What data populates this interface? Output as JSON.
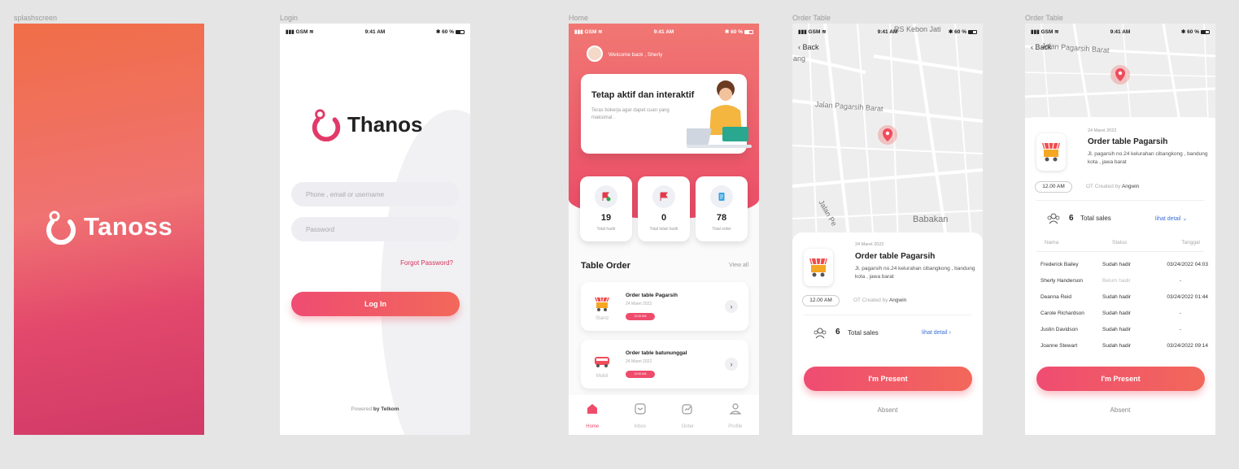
{
  "frames": {
    "splash": "splashscreen",
    "login": "Login",
    "home": "Home",
    "order1": "Order Table",
    "order2": "Order Table"
  },
  "status_bar": {
    "carrier": "GSM",
    "time": "9:41 AM",
    "battery": "60 %"
  },
  "splash": {
    "brand": "Tanoss"
  },
  "login": {
    "brand": "Thanos",
    "phone_placeholder": "Phone , email or username",
    "password_placeholder": "Password",
    "forgot": "Forgot Password?",
    "login_button": "Log In",
    "powered_prefix": "Powered",
    "powered_by": "by Telkom"
  },
  "home": {
    "welcome": "Welcome back , Sherly",
    "banner_title": "Tetap aktif dan interaktif",
    "banner_sub": "Teras bokerja agar dapet cuan yang maksimal .",
    "stats": [
      {
        "value": "19",
        "label": "Total hadir",
        "icon": "flag-check-icon"
      },
      {
        "value": "0",
        "label": "Total tidak hadir",
        "icon": "flag-icon"
      },
      {
        "value": "78",
        "label": "Total order",
        "icon": "document-icon"
      }
    ],
    "table_order_title": "Table Order",
    "view_all": "View all",
    "orders": [
      {
        "name": "Order table Pagarsih",
        "date": "24 Maret 2022",
        "time": "12:00 AM",
        "type": "Stand",
        "icon": "stand-icon"
      },
      {
        "name": "Order table batununggal",
        "date": "24 Maret 2022",
        "time": "12:00 AM",
        "type": "Mobil",
        "icon": "van-icon"
      }
    ],
    "nav": [
      {
        "label": "Home",
        "icon": "home-icon"
      },
      {
        "label": "Inbox",
        "icon": "inbox-icon"
      },
      {
        "label": "Order",
        "icon": "order-icon"
      },
      {
        "label": "Profile",
        "icon": "profile-icon"
      }
    ]
  },
  "order": {
    "back": "Back",
    "map_streets": [
      "RS Kebon Jati",
      "Jalan Pagarsih Barat",
      "Jalan Pe",
      "Babakan",
      "ang"
    ],
    "map_street2": "Jalan Pagarsih Barat",
    "date": "24 Maret 2022",
    "title": "Order table Pagarsih",
    "address": "Jl. pagarsih no.24 kelurahan cibangkong , bandung kota , jawa barat",
    "time": "12.00 AM",
    "created_by_prefix": "OT Created by",
    "created_by": "Angwin",
    "sales_count": "6",
    "sales_label": "Total sales",
    "detail_link": "lihat detail",
    "present_button": "I'm Present",
    "absent_button": "Absent",
    "table_headers": [
      "Nama",
      "Status",
      "Tanggal"
    ],
    "table_rows": [
      {
        "name": "Frederick Bailey",
        "status": "Sudah hadir",
        "date": "03/24/2022 04:03"
      },
      {
        "name": "Sherly Handerson",
        "status": "Belum hadir",
        "date": "-"
      },
      {
        "name": "Deanna Reid",
        "status": "Sudah hadir",
        "date": "03/24/2022 01:44"
      },
      {
        "name": "Carole Richardson",
        "status": "Sudah hadir",
        "date": "-"
      },
      {
        "name": "Justin Davidson",
        "status": "Sudah hadir",
        "date": "-"
      },
      {
        "name": "Joanne Stewart",
        "status": "Sudah hadir",
        "date": "03/24/2022 09:14"
      }
    ]
  },
  "colors": {
    "primary": "#ef4c6c",
    "accent": "#f2685a",
    "link": "#3b6fd9",
    "background": "#e5e5e5"
  }
}
